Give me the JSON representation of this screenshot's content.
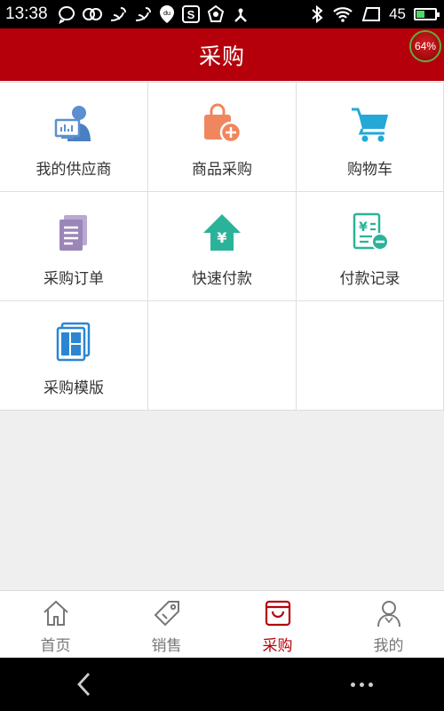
{
  "status_bar": {
    "time": "13:38",
    "battery_text": "45",
    "battery_level_percent": 45,
    "left_icons": [
      "chat-bubble-icon",
      "infinity-icon",
      "uc-browser-icon",
      "uc-browser-icon",
      "baidu-location-icon",
      "s-app-icon",
      "shield-app-icon",
      "share-app-icon"
    ],
    "right_icons": [
      "bluetooth-icon",
      "wifi-icon",
      "signal-icon"
    ]
  },
  "header": {
    "title": "采购",
    "float_badge": "64%"
  },
  "grid": {
    "items": [
      {
        "label": "我的供应商",
        "icon": "supplier-icon",
        "color": "#5b8fd0"
      },
      {
        "label": "商品采购",
        "icon": "shopping-bag-add-icon",
        "color": "#f0865e"
      },
      {
        "label": "购物车",
        "icon": "cart-icon",
        "color": "#23a8d8"
      },
      {
        "label": "采购订单",
        "icon": "document-icon",
        "color": "#9b86b8"
      },
      {
        "label": "快速付款",
        "icon": "yen-house-icon",
        "color": "#2bb399"
      },
      {
        "label": "付款记录",
        "icon": "payment-record-icon",
        "color": "#2bb399"
      },
      {
        "label": "采购模版",
        "icon": "template-icon",
        "color": "#2a86d3"
      }
    ]
  },
  "tabbar": {
    "tabs": [
      {
        "label": "首页",
        "icon": "home-icon",
        "active": false
      },
      {
        "label": "销售",
        "icon": "tag-icon",
        "active": false
      },
      {
        "label": "采购",
        "icon": "purchase-icon",
        "active": true
      },
      {
        "label": "我的",
        "icon": "user-icon",
        "active": false
      }
    ],
    "active_color": "#b5000b"
  },
  "colors": {
    "brand": "#b5000b",
    "background": "#efefef"
  }
}
